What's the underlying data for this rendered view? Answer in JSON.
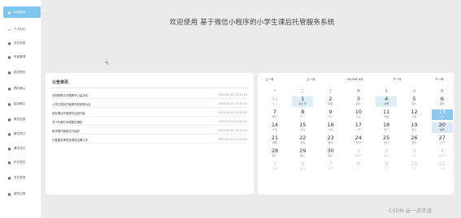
{
  "app": {
    "title": "欢迎使用 基于微信小程序的小学生课后托管服务系统"
  },
  "sidebar": {
    "items": [
      {
        "label": "系统首页",
        "icon": "home-icon",
        "active": true
      },
      {
        "label": "个人中心",
        "icon": "user-icon"
      },
      {
        "label": "学生信息",
        "icon": "student-icon"
      },
      {
        "label": "班级管理",
        "icon": "class-icon"
      },
      {
        "label": "接送预约",
        "icon": "appointment-icon"
      },
      {
        "label": "预约确认",
        "icon": "confirm-icon"
      },
      {
        "label": "接送确认",
        "icon": "pickup-icon"
      },
      {
        "label": "餐饮信息",
        "icon": "food-icon"
      },
      {
        "label": "餐饮预订",
        "icon": "order-icon"
      },
      {
        "label": "餐饮送达",
        "icon": "delivery-icon"
      },
      {
        "label": "作业提交",
        "icon": "homework-icon"
      },
      {
        "label": "学生表现",
        "icon": "performance-icon"
      },
      {
        "label": "服务记录",
        "icon": "record-icon"
      }
    ]
  },
  "notice": {
    "title": "公告资讯",
    "rows": [
      {
        "text": "多部委联合开展教育公益活动",
        "date": "2025-04-11 15:20:14"
      },
      {
        "text": "小学生课后托管服务新政策出台",
        "date": "2025-04-11 15:20:14"
      },
      {
        "text": "我校课后托管服务全面升级",
        "date": "2025-04-11 15:20:14"
      },
      {
        "text": "关于托管时间调整的通知",
        "date": "2025-04-11 15:20:14"
      },
      {
        "text": "新学期托管报名开始啦",
        "date": "2025-04-11 15:20:14"
      },
      {
        "text": "托管服务满意度调查结果公布",
        "date": "2025-04-11 15:20:14"
      }
    ]
  },
  "calendar": {
    "prev_year": "上一年",
    "prev_month": "上一月",
    "current": "2025年 4月",
    "next_month": "下一月",
    "next_year": "下一年",
    "weekdays": [
      "一",
      "二",
      "三",
      "四",
      "五",
      "六",
      "日"
    ],
    "days": [
      {
        "n": "31",
        "l": "初三",
        "other": true
      },
      {
        "n": "1",
        "l": "愚人节",
        "hl": true
      },
      {
        "n": "2",
        "l": "初五"
      },
      {
        "n": "3",
        "l": "初六"
      },
      {
        "n": "4",
        "l": "清明",
        "hl": true
      },
      {
        "n": "5",
        "l": "初八"
      },
      {
        "n": "6",
        "l": "初九"
      },
      {
        "n": "7",
        "l": "初十"
      },
      {
        "n": "8",
        "l": "十一"
      },
      {
        "n": "9",
        "l": "十二"
      },
      {
        "n": "10",
        "l": "十三"
      },
      {
        "n": "11",
        "l": "十四"
      },
      {
        "n": "12",
        "l": "十五"
      },
      {
        "n": "13",
        "l": "十六",
        "today": true
      },
      {
        "n": "14",
        "l": "十七"
      },
      {
        "n": "15",
        "l": "十八"
      },
      {
        "n": "16",
        "l": "十九"
      },
      {
        "n": "17",
        "l": "二十"
      },
      {
        "n": "18",
        "l": "廿一"
      },
      {
        "n": "19",
        "l": "廿二"
      },
      {
        "n": "20",
        "l": "谷雨",
        "sel": true
      },
      {
        "n": "21",
        "l": "廿四"
      },
      {
        "n": "22",
        "l": "廿五"
      },
      {
        "n": "23",
        "l": "廿六"
      },
      {
        "n": "24",
        "l": "廿七"
      },
      {
        "n": "25",
        "l": "廿八"
      },
      {
        "n": "26",
        "l": "廿九"
      },
      {
        "n": "27",
        "l": "三十"
      },
      {
        "n": "28",
        "l": "初一"
      },
      {
        "n": "29",
        "l": "初二"
      },
      {
        "n": "30",
        "l": "初三"
      },
      {
        "n": "1",
        "l": "劳动节",
        "other": true
      },
      {
        "n": "2",
        "l": "初五",
        "other": true
      },
      {
        "n": "3",
        "l": "初六",
        "other": true
      },
      {
        "n": "4",
        "l": "青年节",
        "other": true
      },
      {
        "n": "5",
        "l": "立夏",
        "other": true
      },
      {
        "n": "6",
        "l": "初九",
        "other": true
      },
      {
        "n": "7",
        "l": "初十",
        "other": true
      },
      {
        "n": "8",
        "l": "十一",
        "other": true
      },
      {
        "n": "9",
        "l": "十二",
        "other": true
      },
      {
        "n": "10",
        "l": "十三",
        "other": true
      },
      {
        "n": "11",
        "l": "十四",
        "other": true
      }
    ]
  },
  "watermark": "CSDN @一点毕设"
}
